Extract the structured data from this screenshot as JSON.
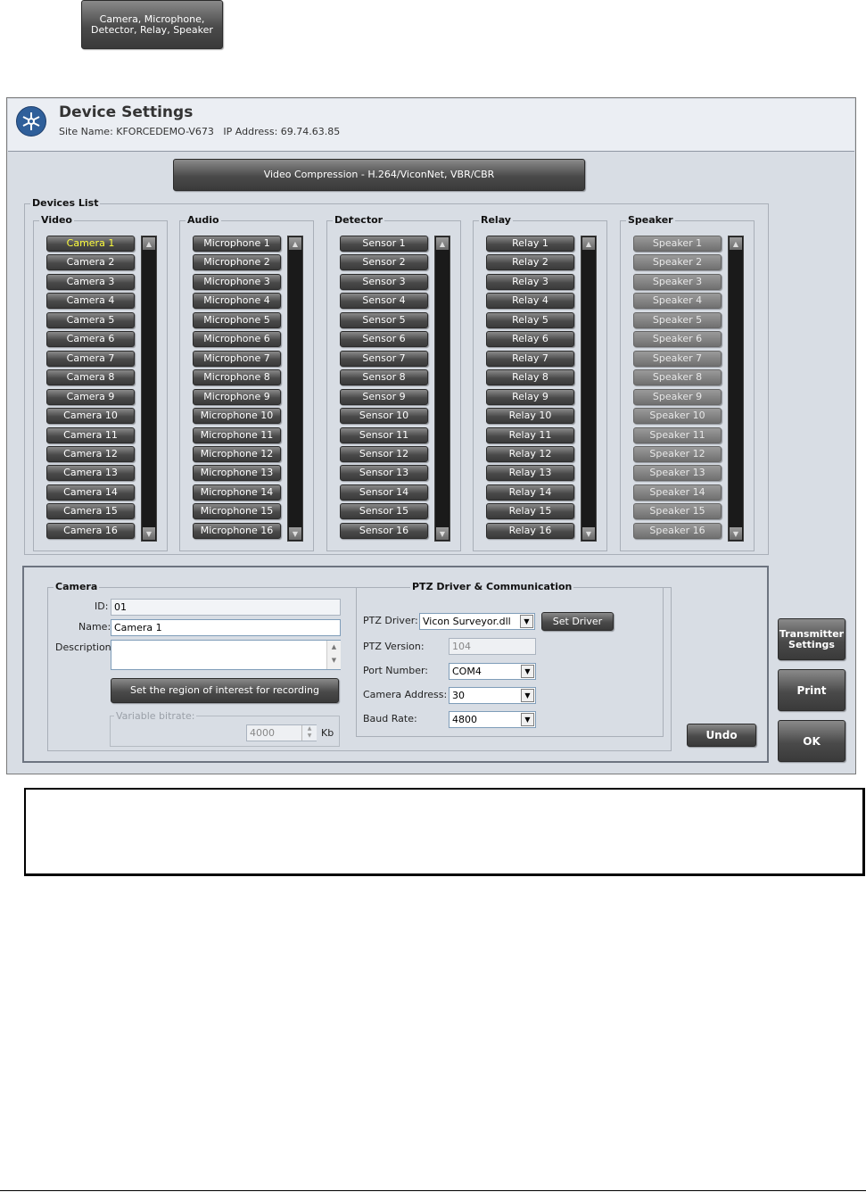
{
  "top_badge": "Camera, Microphone,\nDetector, Relay, Speaker",
  "window": {
    "title": "Device Settings",
    "site_label": "Site Name: KFORCEDEMO-V673",
    "ip_label": "IP Address: 69.74.63.85",
    "compression_button": "Video Compression - H.264/ViconNet, VBR/CBR"
  },
  "devices_list": {
    "label": "Devices List",
    "columns": [
      {
        "label": "Video",
        "items": [
          "Camera 1",
          "Camera 2",
          "Camera 3",
          "Camera 4",
          "Camera 5",
          "Camera 6",
          "Camera 7",
          "Camera 8",
          "Camera 9",
          "Camera 10",
          "Camera 11",
          "Camera 12",
          "Camera 13",
          "Camera 14",
          "Camera 15",
          "Camera 16"
        ]
      },
      {
        "label": "Audio",
        "items": [
          "Microphone 1",
          "Microphone 2",
          "Microphone 3",
          "Microphone 4",
          "Microphone 5",
          "Microphone 6",
          "Microphone 7",
          "Microphone 8",
          "Microphone 9",
          "Microphone 10",
          "Microphone 11",
          "Microphone 12",
          "Microphone 13",
          "Microphone 14",
          "Microphone 15",
          "Microphone 16"
        ]
      },
      {
        "label": "Detector",
        "items": [
          "Sensor 1",
          "Sensor 2",
          "Sensor 3",
          "Sensor 4",
          "Sensor 5",
          "Sensor 6",
          "Sensor 7",
          "Sensor 8",
          "Sensor 9",
          "Sensor 10",
          "Sensor 11",
          "Sensor 12",
          "Sensor 13",
          "Sensor 14",
          "Sensor 15",
          "Sensor 16"
        ]
      },
      {
        "label": "Relay",
        "items": [
          "Relay 1",
          "Relay 2",
          "Relay 3",
          "Relay 4",
          "Relay 5",
          "Relay 6",
          "Relay 7",
          "Relay 8",
          "Relay 9",
          "Relay 10",
          "Relay 11",
          "Relay 12",
          "Relay 13",
          "Relay 14",
          "Relay 15",
          "Relay 16"
        ]
      },
      {
        "label": "Speaker",
        "items": [
          "Speaker 1",
          "Speaker 2",
          "Speaker 3",
          "Speaker 4",
          "Speaker 5",
          "Speaker 6",
          "Speaker 7",
          "Speaker 8",
          "Speaker 9",
          "Speaker 10",
          "Speaker 11",
          "Speaker 12",
          "Speaker 13",
          "Speaker 14",
          "Speaker 15",
          "Speaker 16"
        ]
      }
    ],
    "selected": "Camera 1"
  },
  "camera_panel": {
    "label": "Camera",
    "id_label": "ID:",
    "id_value": "01",
    "name_label": "Name:",
    "name_value": "Camera 1",
    "description_label": "Description:",
    "description_value": "",
    "roi_button": "Set the region of interest for recording",
    "variable_bitrate_label": "Variable bitrate:",
    "bitrate_value": "4000",
    "bitrate_unit": "Kb"
  },
  "ptz": {
    "label": "PTZ Driver & Communication",
    "driver_label": "PTZ Driver:",
    "driver_value": "Vicon Surveyor.dll",
    "set_driver_button": "Set Driver",
    "version_label": "PTZ Version:",
    "version_value": "104",
    "port_label": "Port Number:",
    "port_value": "COM4",
    "address_label": "Camera Address:",
    "address_value": "30",
    "baud_label": "Baud Rate:",
    "baud_value": "4800"
  },
  "buttons": {
    "undo": "Undo",
    "transmitter_settings": "Transmitter\nSettings",
    "print": "Print",
    "ok": "OK"
  }
}
